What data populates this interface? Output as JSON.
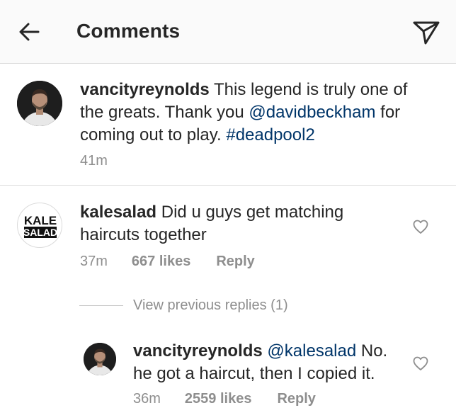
{
  "header": {
    "title": "Comments",
    "back_icon": "arrow-left-icon",
    "share_icon": "paper-plane-icon"
  },
  "caption": {
    "username": "vancityreynolds",
    "text_before_mention": " This legend is truly one of the greats. Thank you ",
    "mention": "@davidbeckham",
    "text_after_mention": " for coming out to play. ",
    "hashtag": "#deadpool2",
    "time": "41m"
  },
  "comments": [
    {
      "username": "kalesalad",
      "avatar_text_top": "KALE",
      "avatar_text_bottom": "SALAD",
      "text": " Did u guys get matching haircuts together",
      "time": "37m",
      "likes": "667 likes",
      "reply_label": "Reply",
      "like_icon": "heart-outline-icon"
    }
  ],
  "view_previous": "View previous replies (1)",
  "replies": [
    {
      "username": "vancityreynolds",
      "mention": "@kalesalad",
      "text": " No. he got a haircut, then I copied it.",
      "time": "36m",
      "likes": "2559 likes",
      "reply_label": "Reply",
      "like_icon": "heart-outline-icon"
    }
  ],
  "colors": {
    "text": "#262626",
    "secondary": "#8e8e8e",
    "link": "#003569",
    "divider": "#dbdbdb",
    "header_bg": "#fafafa"
  }
}
